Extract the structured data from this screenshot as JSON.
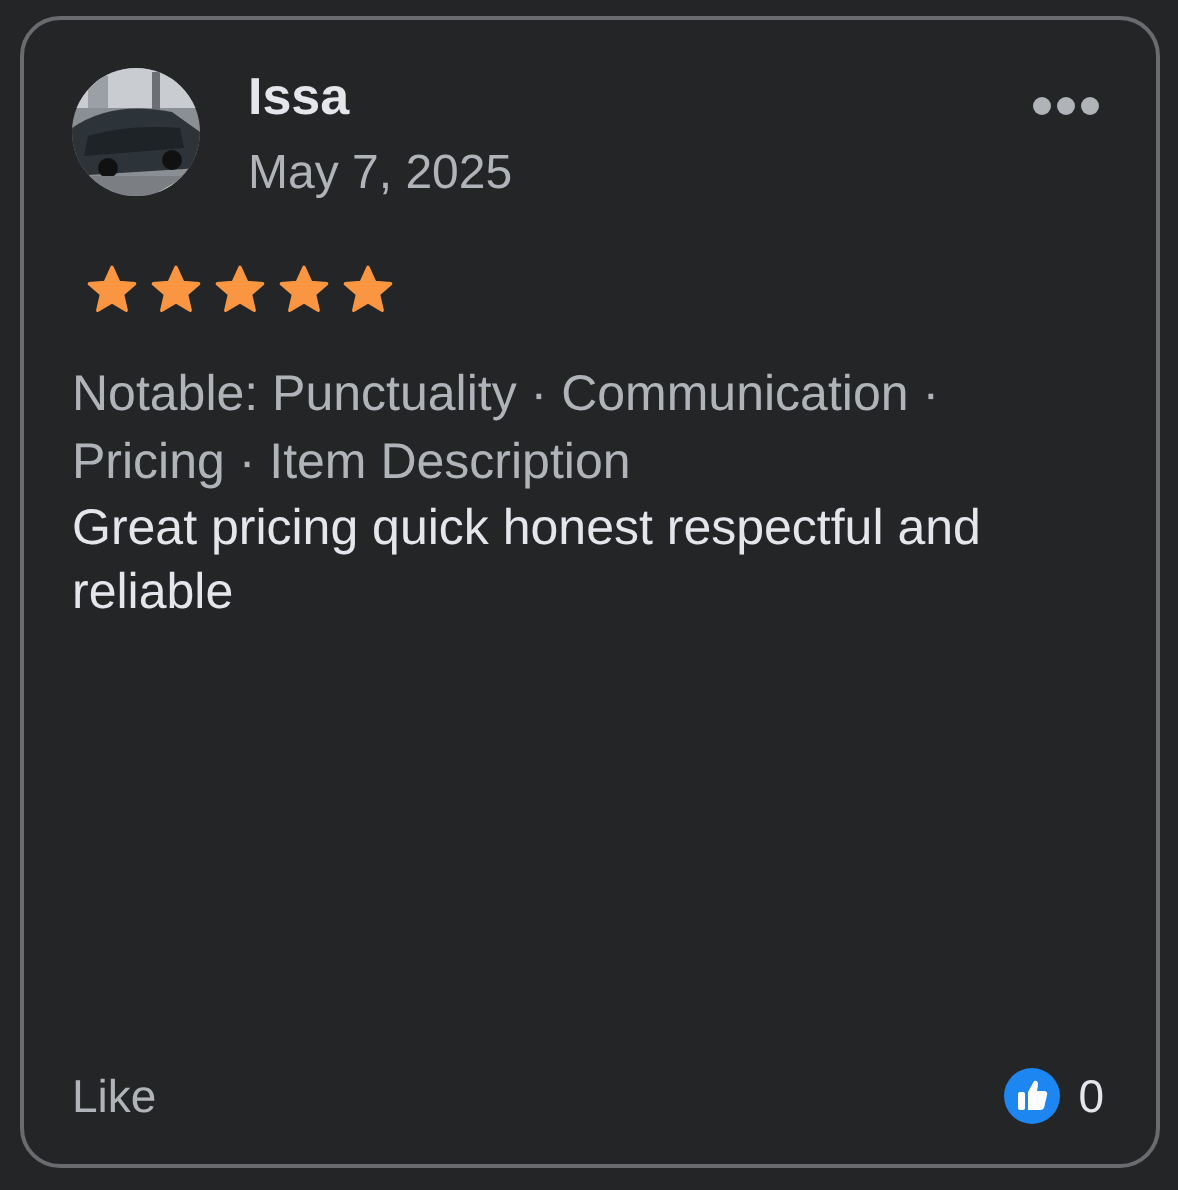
{
  "review": {
    "author": "Issa",
    "date": "May 7, 2025",
    "stars": 5,
    "notable": "Notable: Punctuality · Communication · Pricing · Item Description",
    "text": "Great pricing quick honest respectful and reliable",
    "like_label": "Like",
    "like_count": "0"
  }
}
